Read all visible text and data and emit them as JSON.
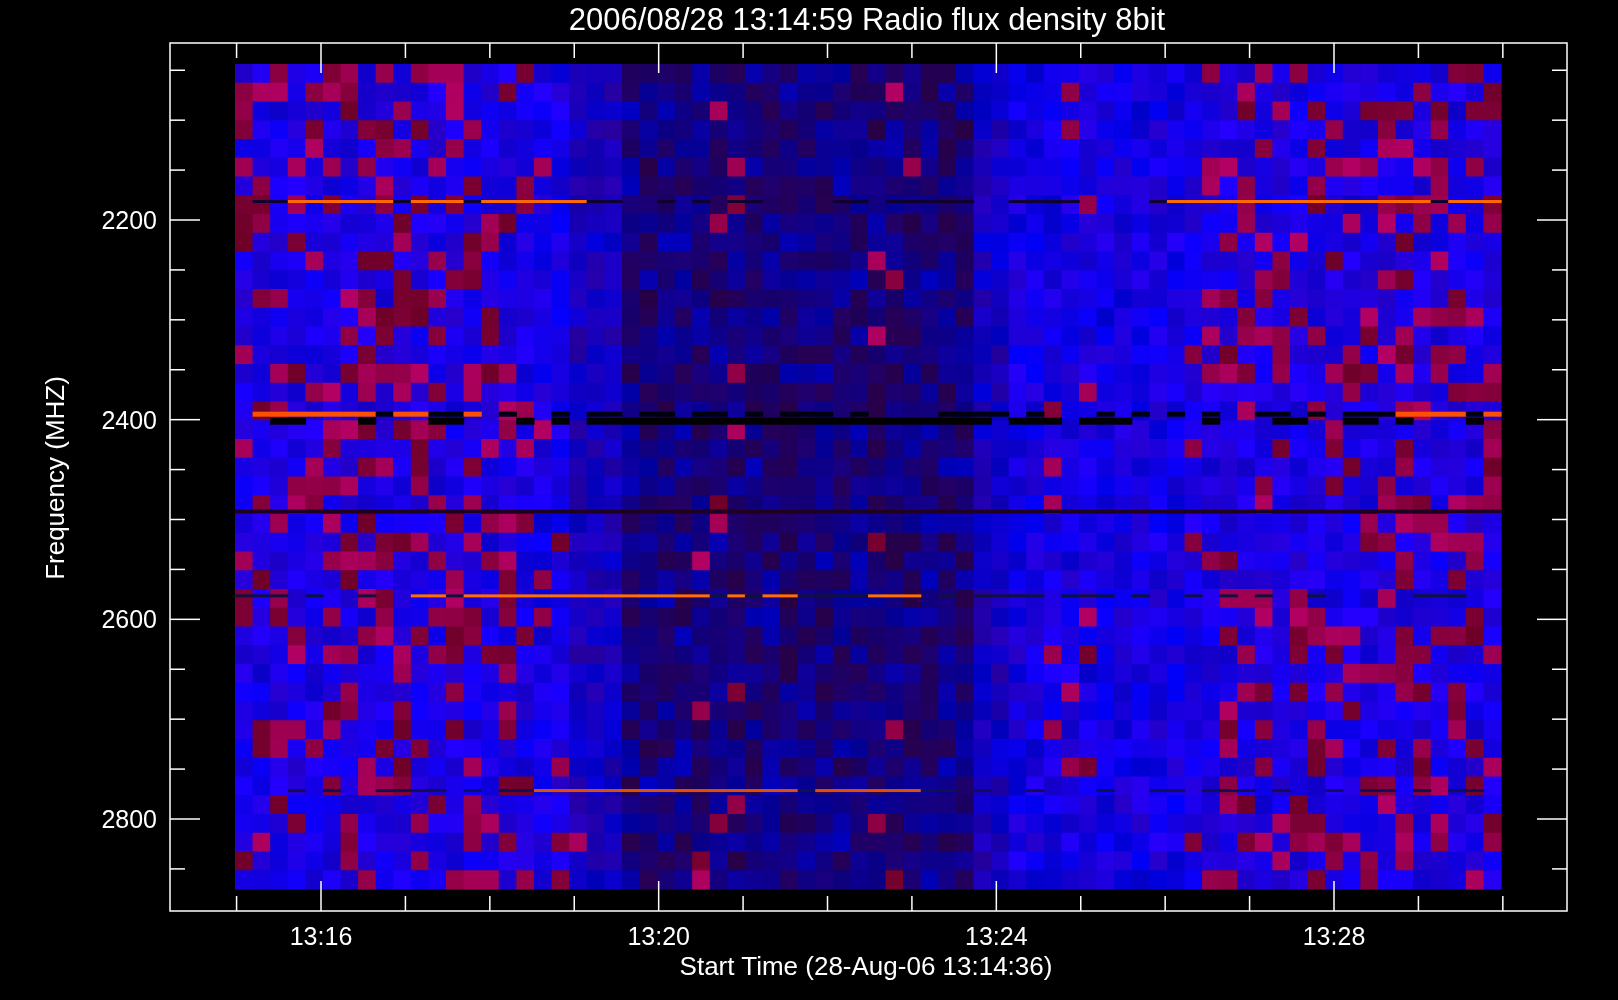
{
  "title": "2006/08/28 13:14:59 Radio flux density 8bit",
  "plot": {
    "ylabel": "Frequency (MHZ)",
    "xlabel": "Start Time (28-Aug-06 13:14:36)",
    "yticks": [
      "2200",
      "2400",
      "2600",
      "2800"
    ],
    "xticks": [
      "13:16",
      "13:20",
      "13:24",
      "13:28"
    ]
  }
}
